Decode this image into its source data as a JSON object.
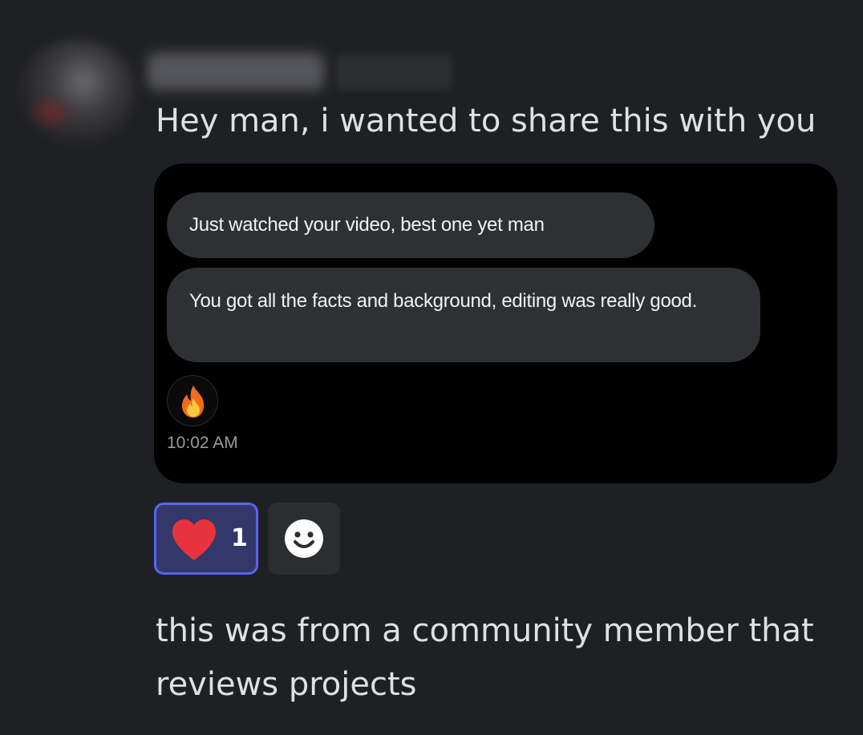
{
  "message": {
    "text": "Hey man, i wanted to share this with you"
  },
  "attachment": {
    "bubbles": [
      "Just watched your video, best one yet man",
      "You got all the facts and background, editing was really good."
    ],
    "reaction_icon": "fire-icon",
    "time": "10:02 AM"
  },
  "reactions": {
    "heart_icon": "heart-icon",
    "heart_count": "1",
    "add_icon": "smiley-icon",
    "accent_color": "#5865f2"
  },
  "followup": {
    "text": "this was from a community member that reviews projects"
  }
}
